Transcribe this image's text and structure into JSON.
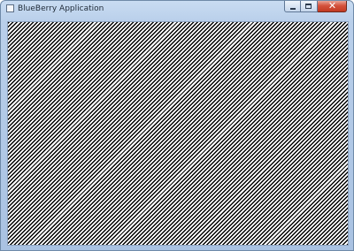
{
  "window": {
    "title": "BlueBerry Application",
    "app_icon": "application-icon"
  },
  "caption_buttons": {
    "minimize_icon": "minimize-icon",
    "maximize_icon": "maximize-icon",
    "close_icon": "close-icon",
    "close_glyph": "✕"
  },
  "client": {
    "pattern": "diagonal-stripes",
    "stripe_color": "#000000",
    "background_color": "#ffffff"
  },
  "colors": {
    "frame": "#b9cfea",
    "close_button": "#c9452d"
  }
}
